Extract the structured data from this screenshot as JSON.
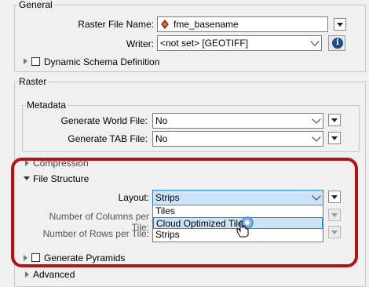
{
  "general": {
    "title": "General",
    "raster_file_name_label": "Raster File Name:",
    "raster_file_name_value": "fme_basename",
    "writer_label": "Writer:",
    "writer_value": "<not set> [GEOTIFF]",
    "info_glyph": "i",
    "dynamic_schema_label": "Dynamic Schema Definition",
    "dynamic_schema_checked": false
  },
  "raster": {
    "title": "Raster",
    "metadata": {
      "title": "Metadata",
      "world_file_label": "Generate World File:",
      "world_file_value": "No",
      "tab_file_label": "Generate TAB File:",
      "tab_file_value": "No"
    },
    "compression_label": "Compression",
    "file_structure": {
      "title": "File Structure",
      "layout_label": "Layout:",
      "layout_value": "Strips",
      "layout_options": [
        "Tiles",
        "Cloud Optimized Tiles",
        "Strips"
      ],
      "hovered_option": "Cloud Optimized Tiles",
      "columns_label": "Number of Columns per Tile:",
      "rows_label": "Number of Rows per Tile:"
    },
    "generate_pyramids_label": "Generate Pyramids",
    "generate_pyramids_checked": false,
    "advanced_label": "Advanced"
  },
  "colors": {
    "annotation_ring": "#b3121a",
    "selection_blue": "#2a7bd5",
    "info_blue": "#1f4e8c"
  }
}
